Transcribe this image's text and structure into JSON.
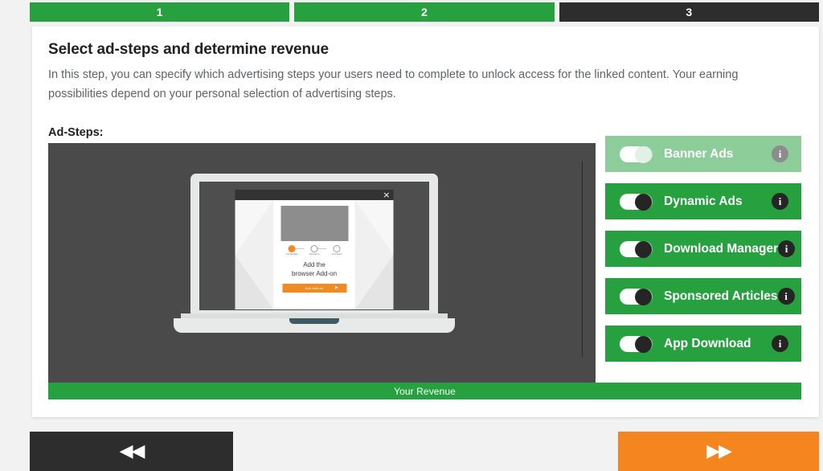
{
  "steps": [
    {
      "label": "1",
      "state": "done"
    },
    {
      "label": "2",
      "state": "done"
    },
    {
      "label": "3",
      "state": "current"
    }
  ],
  "card": {
    "title": "Select ad-steps and determine revenue",
    "description": "In this step, you can specify which advertising steps your users need to complete to unlock access for the linked content. Your earning possibilities depend on your personal selection of advertising steps.",
    "adsteps_label": "Ad-Steps:"
  },
  "preview": {
    "modal": {
      "close_label": "×",
      "stepper": [
        {
          "label": "Your Windows",
          "state": "active"
        },
        {
          "label": "Add Add-on",
          "state": "idle"
        },
        {
          "label": "Get Content",
          "state": "idle"
        }
      ],
      "heading_line1": "Add the",
      "heading_line2": "browser Add-on",
      "cta_label": "Add Add-on",
      "cta_arrow": "▶"
    }
  },
  "revenue": {
    "label": "Your Revenue"
  },
  "toggles": [
    {
      "label": "Banner Ads",
      "on": true,
      "disabled": true,
      "info": "i"
    },
    {
      "label": "Dynamic Ads",
      "on": true,
      "disabled": false,
      "info": "i"
    },
    {
      "label": "Download Manager",
      "on": true,
      "disabled": false,
      "info": "i"
    },
    {
      "label": "Sponsored Articles",
      "on": true,
      "disabled": false,
      "info": "i"
    },
    {
      "label": "App Download",
      "on": true,
      "disabled": false,
      "info": "i"
    }
  ],
  "nav": {
    "back_glyph": "◀◀",
    "next_glyph": "▶▶"
  },
  "colors": {
    "green": "#27a03f",
    "dark": "#2d2d2d",
    "orange": "#f5861f",
    "panel": "#4a4a4a"
  }
}
